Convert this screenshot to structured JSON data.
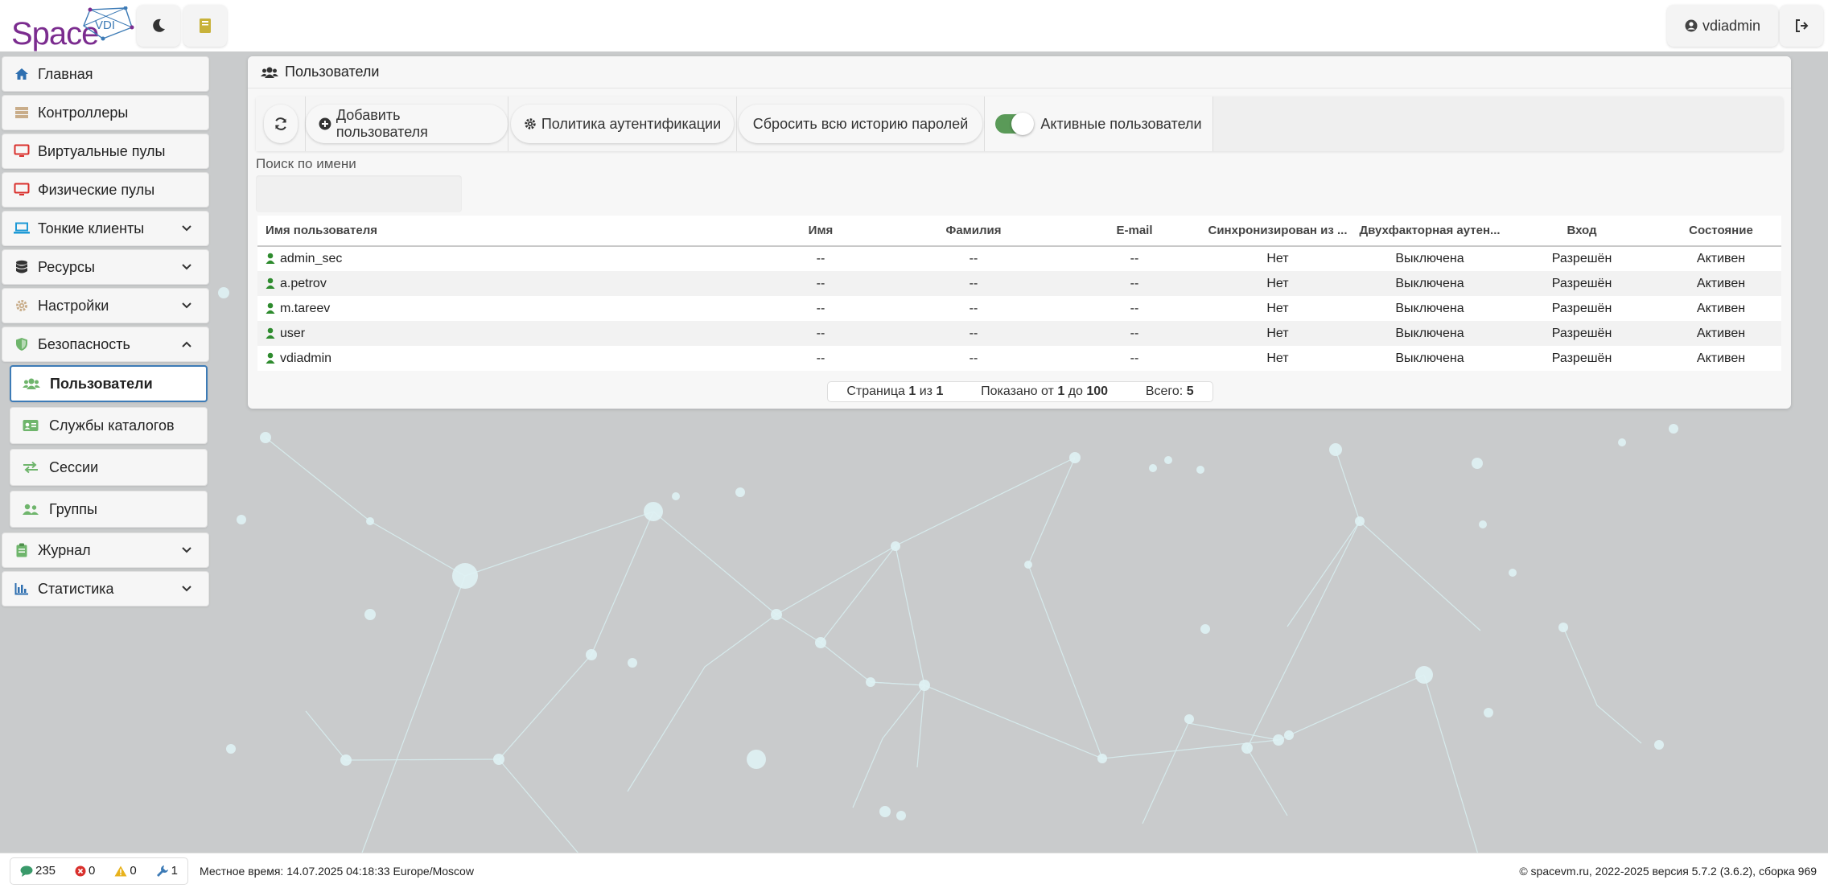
{
  "header": {
    "logo_space": "Space",
    "logo_vdi": "VDI",
    "theme_icon": "moon-icon",
    "docs_icon": "book-icon",
    "user_name": "vdiadmin",
    "logout_icon": "sign-out-icon"
  },
  "sidebar": {
    "items": [
      {
        "label": "Главная",
        "icon": "home-icon"
      },
      {
        "label": "Контроллеры",
        "icon": "server-icon"
      },
      {
        "label": "Виртуальные пулы",
        "icon": "desktop-icon"
      },
      {
        "label": "Физические пулы",
        "icon": "desktop-icon"
      },
      {
        "label": "Тонкие клиенты",
        "icon": "laptop-icon"
      },
      {
        "label": "Ресурсы",
        "icon": "database-icon"
      },
      {
        "label": "Настройки",
        "icon": "gear-icon"
      },
      {
        "label": "Безопасность",
        "icon": "shield-icon"
      }
    ],
    "security_sub": [
      {
        "label": "Пользователи",
        "icon": "users-icon"
      },
      {
        "label": "Службы каталогов",
        "icon": "id-card-icon"
      },
      {
        "label": "Сессии",
        "icon": "exchange-icon"
      },
      {
        "label": "Группы",
        "icon": "users-group-icon"
      }
    ],
    "items_after": [
      {
        "label": "Журнал",
        "icon": "clipboard-icon"
      },
      {
        "label": "Статистика",
        "icon": "bar-chart-icon"
      }
    ]
  },
  "panel": {
    "title": "Пользователи",
    "toolbar": {
      "refresh_icon": "refresh-icon",
      "add_user": "Добавить пользователя",
      "auth_policy": "Политика аутентификации",
      "reset_passwords": "Сбросить всю историю паролей",
      "active_users": "Активные пользователи",
      "active_users_on": true
    },
    "search": {
      "label": "Поиск по имени",
      "value": "",
      "placeholder": ""
    },
    "table": {
      "columns": [
        "Имя пользователя",
        "Имя",
        "Фамилия",
        "E-mail",
        "Синхронизирован из ...",
        "Двухфакторная аутен...",
        "Вход",
        "Состояние"
      ],
      "rows": [
        [
          "admin_sec",
          "--",
          "--",
          "--",
          "Нет",
          "Выключена",
          "Разрешён",
          "Активен"
        ],
        [
          "a.petrov",
          "--",
          "--",
          "--",
          "Нет",
          "Выключена",
          "Разрешён",
          "Активен"
        ],
        [
          "m.tareev",
          "--",
          "--",
          "--",
          "Нет",
          "Выключена",
          "Разрешён",
          "Активен"
        ],
        [
          "user",
          "--",
          "--",
          "--",
          "Нет",
          "Выключена",
          "Разрешён",
          "Активен"
        ],
        [
          "vdiadmin",
          "--",
          "--",
          "--",
          "Нет",
          "Выключена",
          "Разрешён",
          "Активен"
        ]
      ]
    },
    "pager": {
      "page_prefix": "Страница",
      "page": "1",
      "of": "из",
      "pages": "1",
      "shown_prefix": "Показано от",
      "from": "1",
      "to_word": "до",
      "to": "100",
      "total_prefix": "Всего:",
      "total": "5"
    }
  },
  "footer": {
    "messages_count": "235",
    "errors_count": "0",
    "warnings_count": "0",
    "tasks_count": "1",
    "local_time": "Местное время: 14.07.2025 04:18:33 Europe/Moscow",
    "copyright": "© spacevm.ru, 2022-2025 версия 5.7.2 (3.6.2), сборка 969"
  },
  "colors": {
    "brand_purple": "#7b2c8f",
    "accent_blue": "#3d7bb6",
    "toggle_green": "#5a9a58",
    "user_icon_green": "#2e8b2e"
  }
}
